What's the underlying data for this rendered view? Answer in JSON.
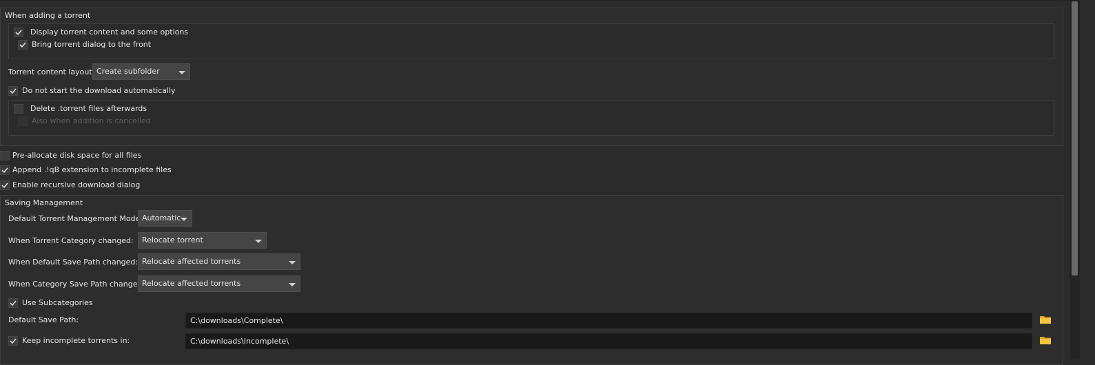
{
  "adding": {
    "group_title": "When adding a torrent",
    "display_content": {
      "label": "Display torrent content and some options",
      "checked": true
    },
    "bring_front": {
      "label": "Bring torrent dialog to the front",
      "checked": true
    },
    "content_layout_label": "Torrent content layout:",
    "content_layout_value": "Create subfolder",
    "do_not_start": {
      "label": "Do not start the download automatically",
      "checked": true
    },
    "delete_torrent_files": {
      "label": "Delete .torrent files afterwards",
      "checked": false
    },
    "also_when_cancelled": {
      "label": "Also when addition is cancelled",
      "checked": false
    }
  },
  "preallocate": {
    "label": "Pre-allocate disk space for all files",
    "checked": false
  },
  "append_ext": {
    "label": "Append .!qB extension to incomplete files",
    "checked": true
  },
  "recursive": {
    "label": "Enable recursive download dialog",
    "checked": true
  },
  "saving": {
    "group_title": "Saving Management",
    "mode_label": "Default Torrent Management Mode:",
    "mode_value": "Automatic",
    "category_changed_label": "When Torrent Category changed:",
    "category_changed_value": "Relocate torrent",
    "default_path_changed_label": "When Default Save Path changed:",
    "default_path_changed_value": "Relocate affected torrents",
    "category_path_changed_label": "When Category Save Path changed:",
    "category_path_changed_value": "Relocate affected torrents",
    "use_subcategories": {
      "label": "Use Subcategories",
      "checked": true
    },
    "default_save_path_label": "Default Save Path:",
    "default_save_path_value": "C:\\downloads\\Complete\\",
    "keep_incomplete": {
      "label": "Keep incomplete torrents in:",
      "checked": true
    },
    "incomplete_path_value": "C:\\downloads\\Incomplete\\"
  },
  "icons": {
    "check": "check-icon",
    "dropdown": "chevron-down-icon",
    "folder": "folder-icon"
  },
  "colors": {
    "background": "#2b2b2b",
    "path_field": "#191919",
    "combo": "#454545",
    "folder": "#f0c040",
    "text": "#e6e6e6"
  }
}
